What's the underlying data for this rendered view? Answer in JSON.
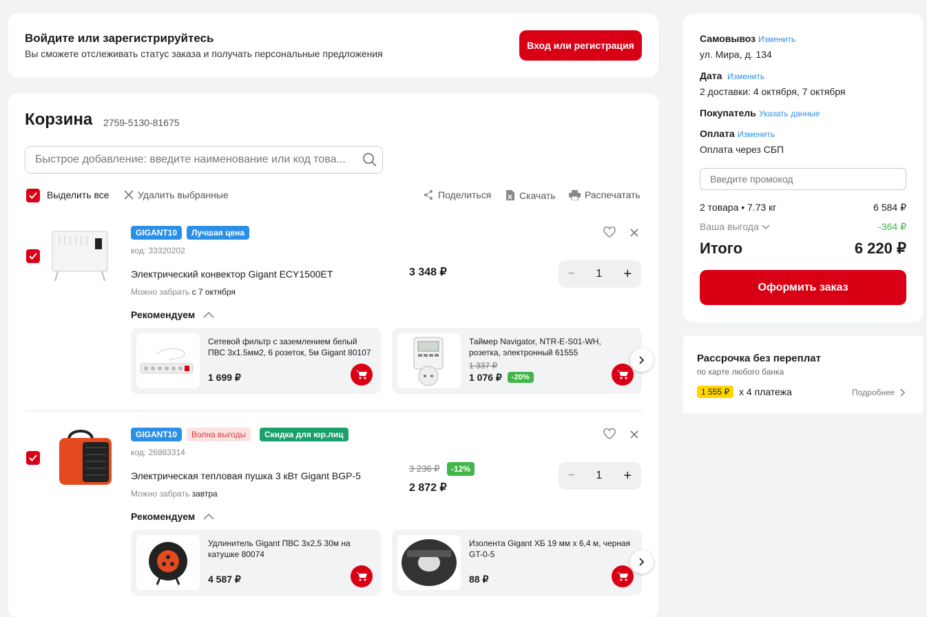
{
  "login": {
    "title": "Войдите или зарегистрируйтесь",
    "subtitle": "Вы сможете отслеживать статус заказа и получать персональные предложения",
    "button": "Вход или регистрация"
  },
  "cart": {
    "title": "Корзина",
    "order_code": "2759-5130-81675",
    "search_placeholder": "Быстрое добавление: введите наименование или код това...",
    "select_all": "Выделить все",
    "delete_selected": "Удалить выбранные",
    "share": "Поделиться",
    "download": "Скачать",
    "print": "Распечатать"
  },
  "items": [
    {
      "tags": [
        "GIGANT10",
        "Лучшая цена"
      ],
      "code": "код: 33320202",
      "name": "Электрический конвектор Gigant ECY1500ET",
      "pickup_label": "Можно забрать",
      "pickup_date": "с 7 октября",
      "price": "3 348 ₽",
      "qty": "1",
      "recommend": "Рекомендуем",
      "recs": [
        {
          "name": "Сетевой фильтр с заземлением белый ПВС 3х1.5мм2, 6 розеток, 5м Gigant 80107",
          "price": "1 699 ₽"
        },
        {
          "name": "Таймер Navigator, NTR-E-S01-WH, розетка, электронный 61555",
          "old": "1 337 ₽",
          "price": "1 076 ₽",
          "disc": "-20%"
        }
      ]
    },
    {
      "tags": [
        "GIGANT10",
        "Волна выгоды",
        "Скидка для юр.лиц"
      ],
      "code": "код: 26883314",
      "name": "Электрическая тепловая пушка 3 кВт Gigant BGP-5",
      "pickup_label": "Можно забрать",
      "pickup_date": "завтра",
      "old_price": "3 236 ₽",
      "discount": "-12%",
      "price": "2 872 ₽",
      "qty": "1",
      "recommend": "Рекомендуем",
      "recs": [
        {
          "name": "Удлинитель Gigant ПВС 3х2,5 30м на катушке 80074",
          "price": "4 587 ₽"
        },
        {
          "name": "Изолента Gigant ХБ 19 мм х 6,4 м, черная GT-0-5",
          "price": "88 ₽"
        }
      ]
    }
  ],
  "summary": {
    "pickup_label": "Самовывоз",
    "pickup_change": "Изменить",
    "pickup_addr": "ул. Мира, д. 134",
    "date_label": "Дата",
    "date_change": "Изменить",
    "date_val": "2 доставки: 4 октября, 7 октября",
    "buyer_label": "Покупатель",
    "buyer_link": "Указать данные",
    "pay_label": "Оплата",
    "pay_change": "Изменить",
    "pay_val": "Оплата через СБП",
    "promo_placeholder": "Введите промокод",
    "goods": "2 товара • 7.73 кг",
    "goods_sum": "6 584 ₽",
    "benefit": "Ваша выгода",
    "benefit_sum": "-364 ₽",
    "total_label": "Итого",
    "total": "6 220 ₽",
    "checkout": "Оформить заказ"
  },
  "installment": {
    "title": "Рассрочка без переплат",
    "subtitle": "по карте любого банка",
    "amount": "1 555 ₽",
    "times": "х 4 платежа",
    "more": "Подробнее"
  }
}
